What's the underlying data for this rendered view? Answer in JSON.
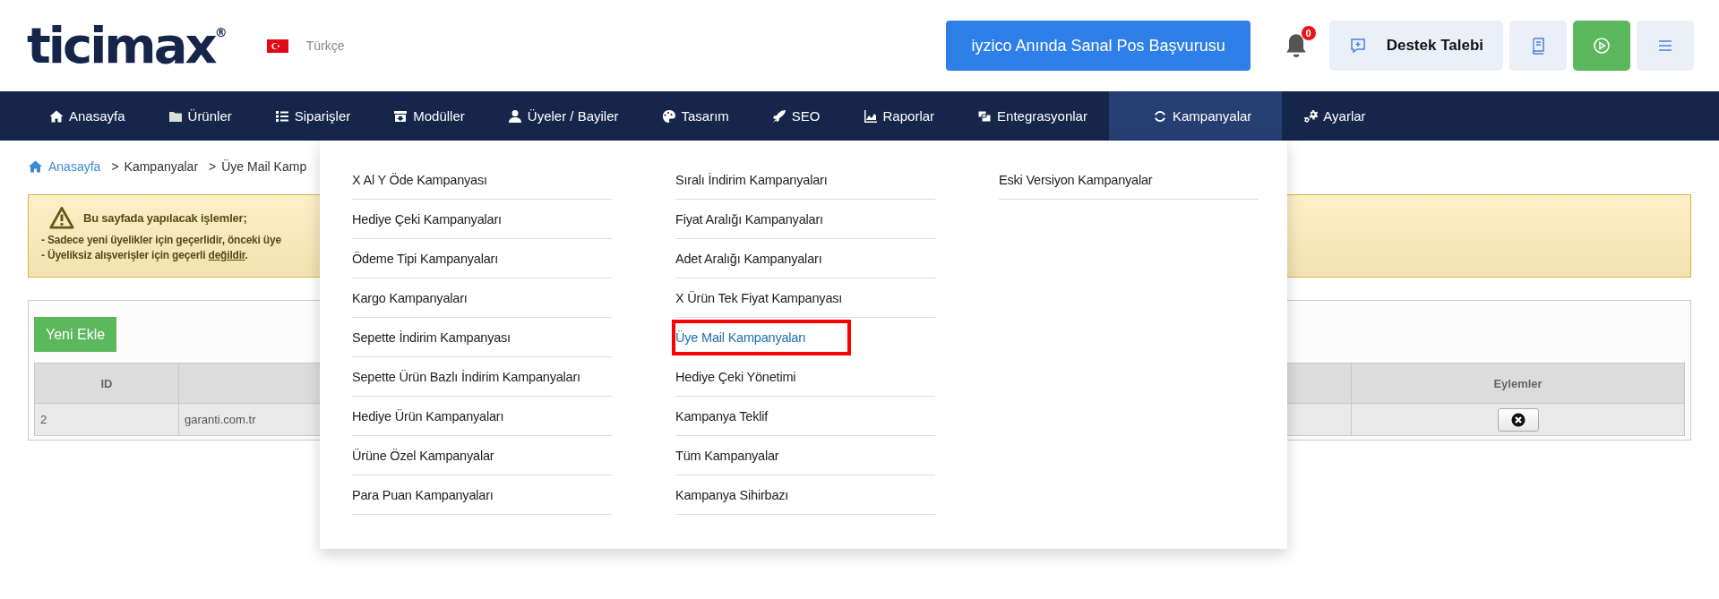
{
  "header": {
    "logo": {
      "text": "ticimax",
      "mark": "®"
    },
    "language": "Türkçe",
    "promo_button": "iyzico Anında Sanal Pos Başvurusu",
    "notifications": "0",
    "support_button": "Destek Talebi"
  },
  "nav": [
    {
      "label": "Anasayfa",
      "kind": "home",
      "selected": false
    },
    {
      "label": "Ürünler",
      "kind": "folder",
      "selected": false
    },
    {
      "label": "Siparişler",
      "kind": "list",
      "selected": false
    },
    {
      "label": "Modüller",
      "kind": "box",
      "selected": false
    },
    {
      "label": "Üyeler / Bayiler",
      "kind": "user",
      "selected": false
    },
    {
      "label": "Tasarım",
      "kind": "palette",
      "selected": false
    },
    {
      "label": "SEO",
      "kind": "rocket",
      "selected": false
    },
    {
      "label": "Raporlar",
      "kind": "chart",
      "selected": false
    },
    {
      "label": "Entegrasyonlar",
      "kind": "windows",
      "selected": false
    },
    {
      "label": "Kampanyalar",
      "kind": "cycle",
      "selected": true
    },
    {
      "label": "Ayarlar",
      "kind": "gears",
      "selected": false
    }
  ],
  "breadcrumb": {
    "separator": ">",
    "items": [
      {
        "label": "Anasayfa",
        "link": true
      },
      {
        "label": "Kampanyalar",
        "link": false
      },
      {
        "label": "Üye Mail Kamp",
        "link": false
      }
    ]
  },
  "alert": {
    "title": "Bu sayfada yapılacak işlemler;",
    "lines": [
      [
        {
          "text": "- Sadece yeni üyelikler için geçerlidir, önceki üye",
          "underline": false
        }
      ],
      [
        {
          "text": "- Üyeliksiz alışverişler için geçerli ",
          "underline": false
        },
        {
          "text": "değildir",
          "underline": true
        },
        {
          "text": ".",
          "underline": false
        }
      ]
    ]
  },
  "table": {
    "add_button": "Yeni Ekle",
    "columns": {
      "id": "ID",
      "actions": "Eylemler"
    },
    "rows": [
      {
        "id": "2",
        "column_2": "garanti.com.tr"
      }
    ]
  },
  "mega_menu": {
    "columns": [
      [
        {
          "label": "X Al Y Öde Kampanyası",
          "selected": false
        },
        {
          "label": "Hediye Çeki Kampanyaları",
          "selected": false
        },
        {
          "label": "Ödeme Tipi Kampanyaları",
          "selected": false
        },
        {
          "label": "Kargo Kampanyaları",
          "selected": false
        },
        {
          "label": "Sepette İndirim Kampanyası",
          "selected": false
        },
        {
          "label": "Sepette Ürün Bazlı İndirim Kampanyaları",
          "selected": false
        },
        {
          "label": "Hediye Ürün Kampanyaları",
          "selected": false
        },
        {
          "label": "Ürüne Özel Kampanyalar",
          "selected": false
        },
        {
          "label": "Para Puan Kampanyaları",
          "selected": false
        }
      ],
      [
        {
          "label": "Sıralı İndirim Kampanyaları",
          "selected": false
        },
        {
          "label": "Fiyat Aralığı Kampanyaları",
          "selected": false
        },
        {
          "label": "Adet Aralığı Kampanyaları",
          "selected": false
        },
        {
          "label": "X Ürün Tek Fiyat Kampanyası",
          "selected": false
        },
        {
          "label": "Üye Mail Kampanyaları",
          "selected": true
        },
        {
          "label": "Hediye Çeki Yönetimi",
          "selected": false
        },
        {
          "label": "Kampanya Teklif",
          "selected": false
        },
        {
          "label": "Tüm Kampanyalar",
          "selected": false
        },
        {
          "label": "Kampanya Sihirbazı",
          "selected": false
        }
      ],
      [
        {
          "label": "Eski Versiyon Kampanyalar",
          "selected": false
        }
      ]
    ]
  }
}
